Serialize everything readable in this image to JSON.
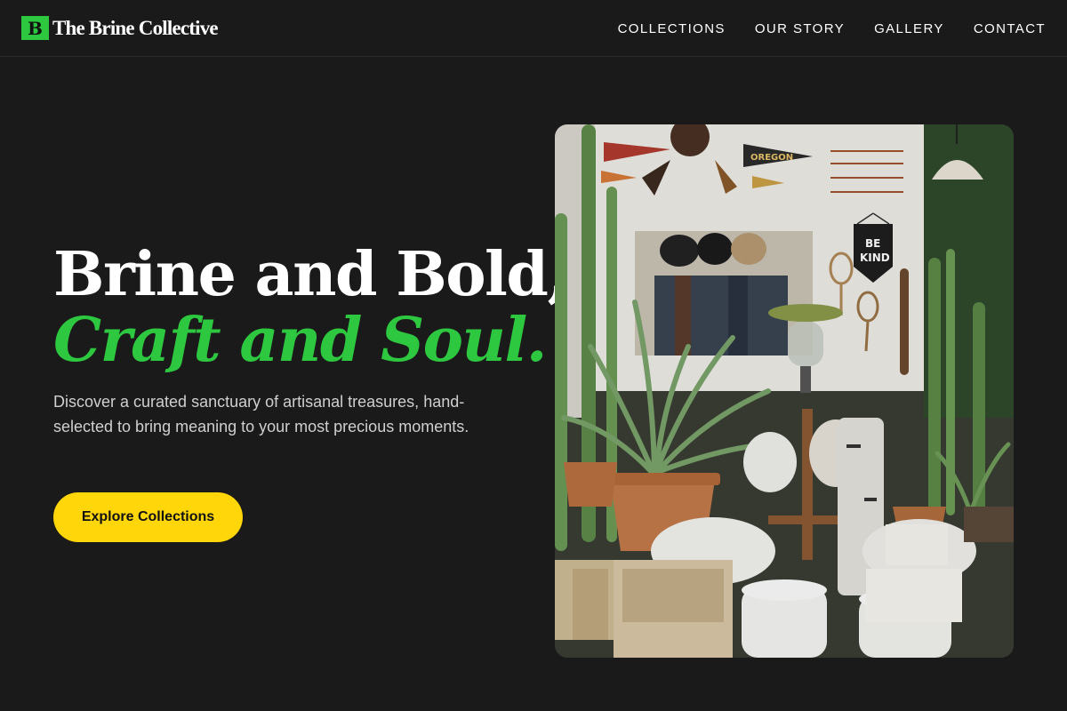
{
  "brand": {
    "mark": "B",
    "name": "The Brine Collective"
  },
  "nav": [
    {
      "label": "COLLECTIONS"
    },
    {
      "label": "OUR STORY"
    },
    {
      "label": "GALLERY"
    },
    {
      "label": "CONTACT"
    }
  ],
  "hero": {
    "headline_line1": "Brine and Bold,",
    "headline_line2": "Craft and Soul.",
    "description": "Discover a curated sanctuary of artisanal treasures, hand-selected to bring meaning to your most precious moments.",
    "cta_label": "Explore Collections",
    "photo": {
      "pennant_text": "OREGON",
      "banner_text_1": "BE",
      "banner_text_2": "KIND"
    }
  },
  "colors": {
    "accent_green": "#2ec840",
    "cta_yellow": "#ffd60a",
    "background": "#1a1a1a"
  }
}
